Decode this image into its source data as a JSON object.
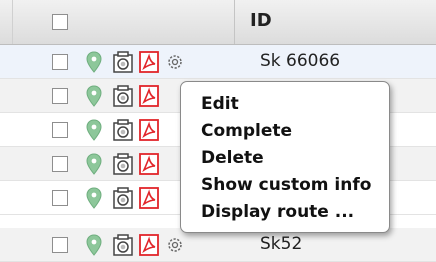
{
  "grid": {
    "header": {
      "id_label": "ID"
    },
    "rows": [
      {
        "id": "Sk 66066"
      },
      {
        "id": ""
      },
      {
        "id": ""
      },
      {
        "id": ""
      },
      {
        "id": ""
      },
      {
        "id": "Sk52"
      }
    ],
    "row_icons": [
      "map-pin-icon",
      "camera-icon",
      "pdf-icon",
      "gear-icon"
    ]
  },
  "context_menu": {
    "items": [
      {
        "label": "Edit"
      },
      {
        "label": "Complete"
      },
      {
        "label": "Delete"
      },
      {
        "label": "Show custom info"
      },
      {
        "label": "Display route ..."
      }
    ]
  },
  "colors": {
    "pin": "#8dc79a",
    "pdf": "#e1252a",
    "header_bg": "#e6e6e6",
    "row_alt_bg": "#f2f2f2"
  }
}
